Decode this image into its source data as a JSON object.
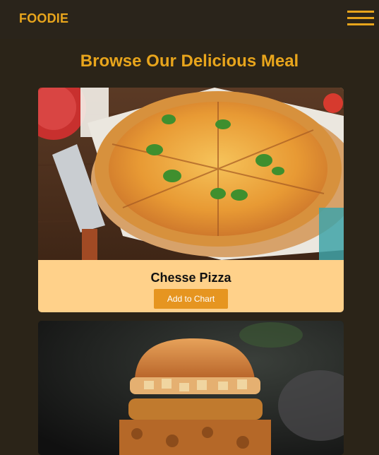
{
  "navbar": {
    "brand": "FOODIE",
    "menu_icon": "hamburger-menu-icon"
  },
  "main": {
    "title": "Browse Our Delicious Meal",
    "meals": [
      {
        "name": "Chesse Pizza",
        "button_label": "Add to Chart"
      },
      {
        "name": "",
        "button_label": ""
      }
    ]
  },
  "colors": {
    "background": "#2b2418",
    "accent": "#e8a51c",
    "card": "#ffd18a",
    "button": "#e69520"
  }
}
